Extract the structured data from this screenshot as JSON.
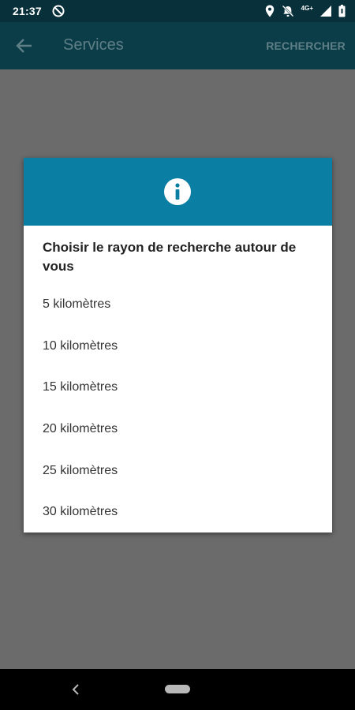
{
  "status_bar": {
    "time": "21:37",
    "network_label": "4G+",
    "icons": [
      "data-saver-icon",
      "location-icon",
      "notifications-off-icon",
      "signal-icon",
      "battery-icon"
    ]
  },
  "app_bar": {
    "title": "Services",
    "action_label": "RECHERCHER",
    "back_icon": "back-arrow-icon"
  },
  "dialog": {
    "header_icon": "info-icon",
    "header_color": "#0b7ea4",
    "title": "Choisir le rayon de recherche autour de vous",
    "options": [
      "5 kilomètres",
      "10 kilomètres",
      "15 kilomètres",
      "20 kilomètres",
      "25 kilomètres",
      "30 kilomètres"
    ]
  },
  "nav_bar": {
    "icons": [
      "nav-back-icon",
      "nav-home-pill"
    ]
  },
  "colors": {
    "status_bar": "#08303b",
    "app_bar": "#0b3d48",
    "scrim": "#6b6b6b"
  }
}
